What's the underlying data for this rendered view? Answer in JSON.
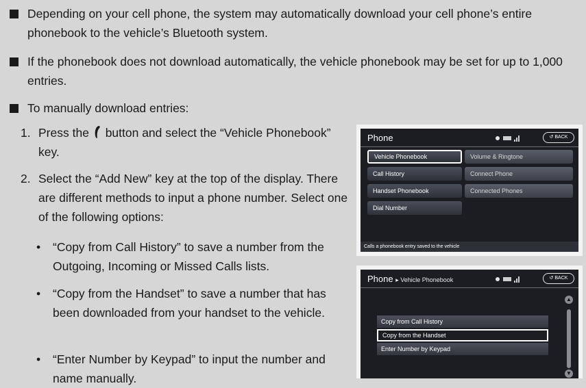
{
  "bullets": [
    "Depending on your cell phone, the system may automatically download your cell phone’s entire phonebook to the vehicle’s Bluetooth system.",
    "If the phonebook does not download automatically, the vehicle phonebook may be set for up to 1,000 entries.",
    "To manually download entries:"
  ],
  "steps": [
    {
      "num": "1.",
      "before": "Press the",
      "after": "button and select the “Vehicle Phonebook” key."
    },
    {
      "num": "2.",
      "text": "Select the “Add New” key at the top of the display. There are different methods to input a phone number. Select one of the following options:"
    }
  ],
  "sub_bullets": [
    {
      "marker": "•",
      "text": "“Copy from Call History” to save a number from the Outgoing, Incoming or Missed Calls lists."
    },
    {
      "marker": "•",
      "text": "“Copy from the Handset” to save a number that has been downloaded from your handset to the vehicle."
    },
    {
      "marker": "•",
      "text": "“Enter Number by Keypad” to input the number and name manually."
    }
  ],
  "screen1": {
    "title": "Phone",
    "back": "BACK",
    "left_keys": [
      "Vehicle Phonebook",
      "Call History",
      "Handset Phonebook",
      "Dial Number"
    ],
    "right_keys": [
      "Volume & Ringtone",
      "Connect Phone",
      "Connected Phones"
    ],
    "footer": "Calls a phonebook entry saved to the vehicle",
    "selected": "Vehicle Phonebook"
  },
  "screen2": {
    "title": "Phone",
    "crumb": "▸ Vehicle Phonebook",
    "back": "BACK",
    "options": [
      "Copy from Call History",
      "Copy from the Handset",
      "Enter Number by Keypad"
    ],
    "selected": "Copy from the Handset"
  },
  "icons": [
    "phone-handset-icon",
    "bluetooth-icon",
    "battery-icon",
    "signal-icon",
    "back-arrow-icon",
    "scroll-up-icon",
    "scroll-down-icon"
  ]
}
